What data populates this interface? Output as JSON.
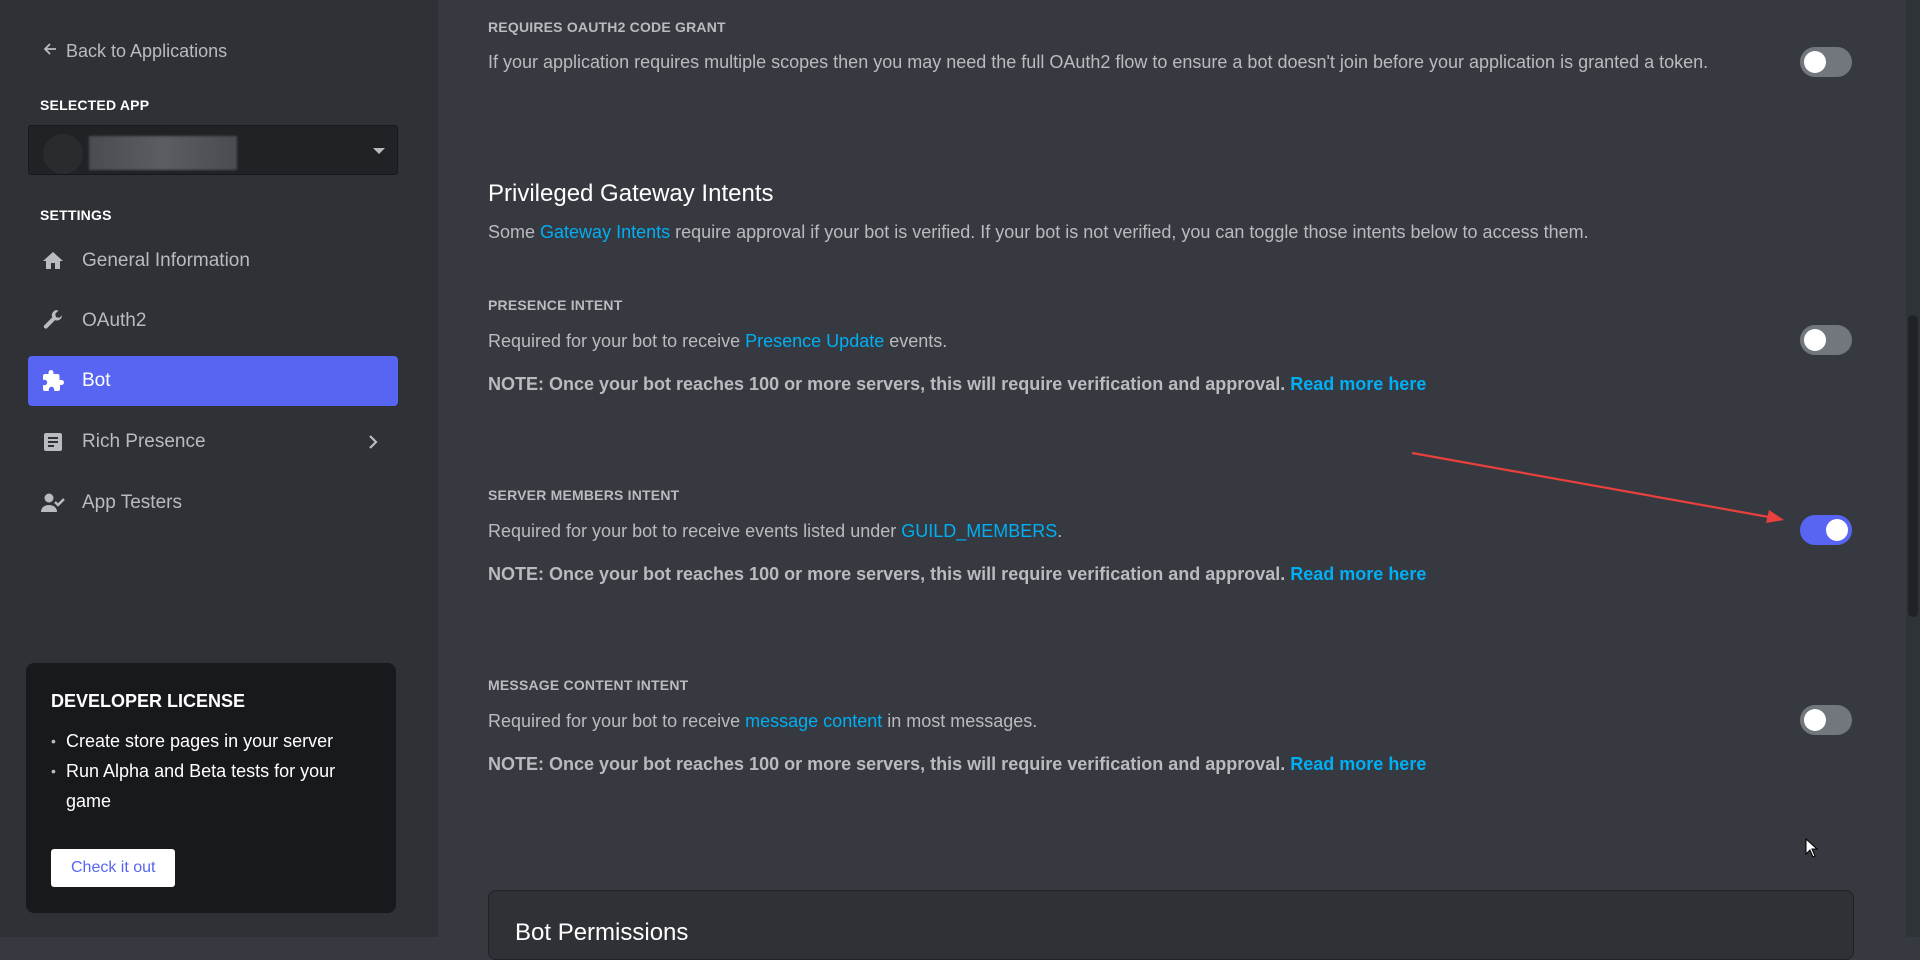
{
  "sidebar": {
    "back_label": "Back to Applications",
    "selected_app_label": "SELECTED APP",
    "settings_label": "SETTINGS",
    "items": [
      {
        "label": "General Information",
        "icon": "home-icon"
      },
      {
        "label": "OAuth2",
        "icon": "wrench-icon"
      },
      {
        "label": "Bot",
        "icon": "puzzle-icon",
        "active": true
      },
      {
        "label": "Rich Presence",
        "icon": "document-icon",
        "has_chevron": true
      },
      {
        "label": "App Testers",
        "icon": "user-check-icon"
      }
    ],
    "dev_license": {
      "title": "DEVELOPER LICENSE",
      "bullets": [
        "Create store pages in your server",
        "Run Alpha and Beta tests for your game"
      ],
      "button_label": "Check it out"
    }
  },
  "main": {
    "oauth2_code_grant": {
      "heading": "REQUIRES OAUTH2 CODE GRANT",
      "description": "If your application requires multiple scopes then you may need the full OAuth2 flow to ensure a bot doesn't join before your application is granted a token.",
      "enabled": false
    },
    "section_title": "Privileged Gateway Intents",
    "section_desc": {
      "prefix": "Some ",
      "link": "Gateway Intents",
      "suffix": " require approval if your bot is verified. If your bot is not verified, you can toggle those intents below to access them."
    },
    "intents": [
      {
        "heading": "PRESENCE INTENT",
        "desc_prefix": "Required for your bot to receive ",
        "desc_link": "Presence Update",
        "desc_suffix": " events.",
        "note": "NOTE: Once your bot reaches 100 or more servers, this will require verification and approval.",
        "note_link": "Read more here",
        "enabled": false
      },
      {
        "heading": "SERVER MEMBERS INTENT",
        "desc_prefix": "Required for your bot to receive events listed under ",
        "desc_link": "GUILD_MEMBERS",
        "desc_suffix": ".",
        "note": "NOTE: Once your bot reaches 100 or more servers, this will require verification and approval.",
        "note_link": "Read more here",
        "enabled": true
      },
      {
        "heading": "MESSAGE CONTENT INTENT",
        "desc_prefix": "Required for your bot to receive ",
        "desc_link": "message content",
        "desc_suffix": " in most messages.",
        "note": "NOTE: Once your bot reaches 100 or more servers, this will require verification and approval.",
        "note_link": "Read more here",
        "enabled": false
      }
    ],
    "bot_permissions_title": "Bot Permissions"
  },
  "colors": {
    "accent": "#5865f2",
    "link": "#00aff4",
    "annotation_arrow": "#e8403c",
    "toggle_off": "#72767d"
  }
}
